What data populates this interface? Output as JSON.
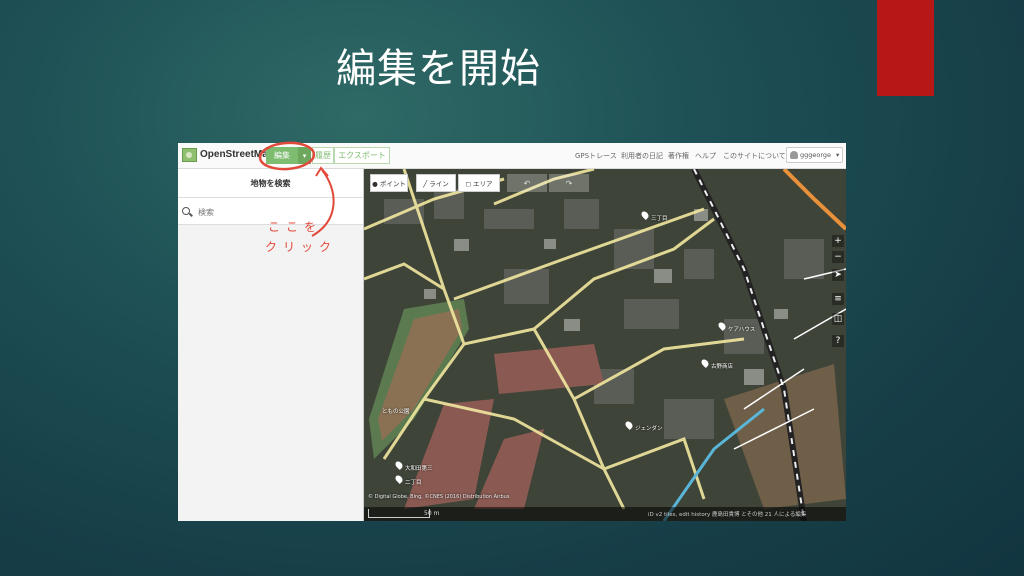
{
  "slide": {
    "title": "編集を開始"
  },
  "app": {
    "brand": "OpenStreetMap",
    "edit_label": "編集",
    "edit_dropdown": "▾",
    "history_label": "履歴",
    "export_label": "エクスポート",
    "nav_links": [
      "GPSトレース",
      "利用者の日記",
      "著作権",
      "ヘルプ",
      "このサイトについて"
    ],
    "username": "gggeorge",
    "user_dropdown": "▾"
  },
  "sidebar": {
    "title": "地物を検索",
    "search_placeholder": "検索"
  },
  "map": {
    "tools": {
      "point": "ポイント",
      "line": "ライン",
      "area": "エリア"
    },
    "undo_icon": "↶",
    "redo_icon": "↷",
    "controls": [
      "+",
      "−",
      "➤",
      "≡",
      "◫",
      "?"
    ],
    "poi_labels": [
      "三丁目",
      "ケアハウス",
      "古野商店",
      "ともの公園",
      "大和田第三",
      "ジェンダン",
      "二丁目"
    ],
    "attribution": "© Digital Globe, Bing, ©CNES (2016) Distribution Airbus",
    "scale": "50 m",
    "footer": "iD v2 tiles, edit history 鹿島田貴博  とその他 21 人による編集"
  },
  "annotation": {
    "line1": "ここを",
    "line2": "クリック",
    "color": "#e14a3b"
  },
  "colors": {
    "accent_red": "#b81717",
    "osm_green": "#7ebc6f"
  }
}
